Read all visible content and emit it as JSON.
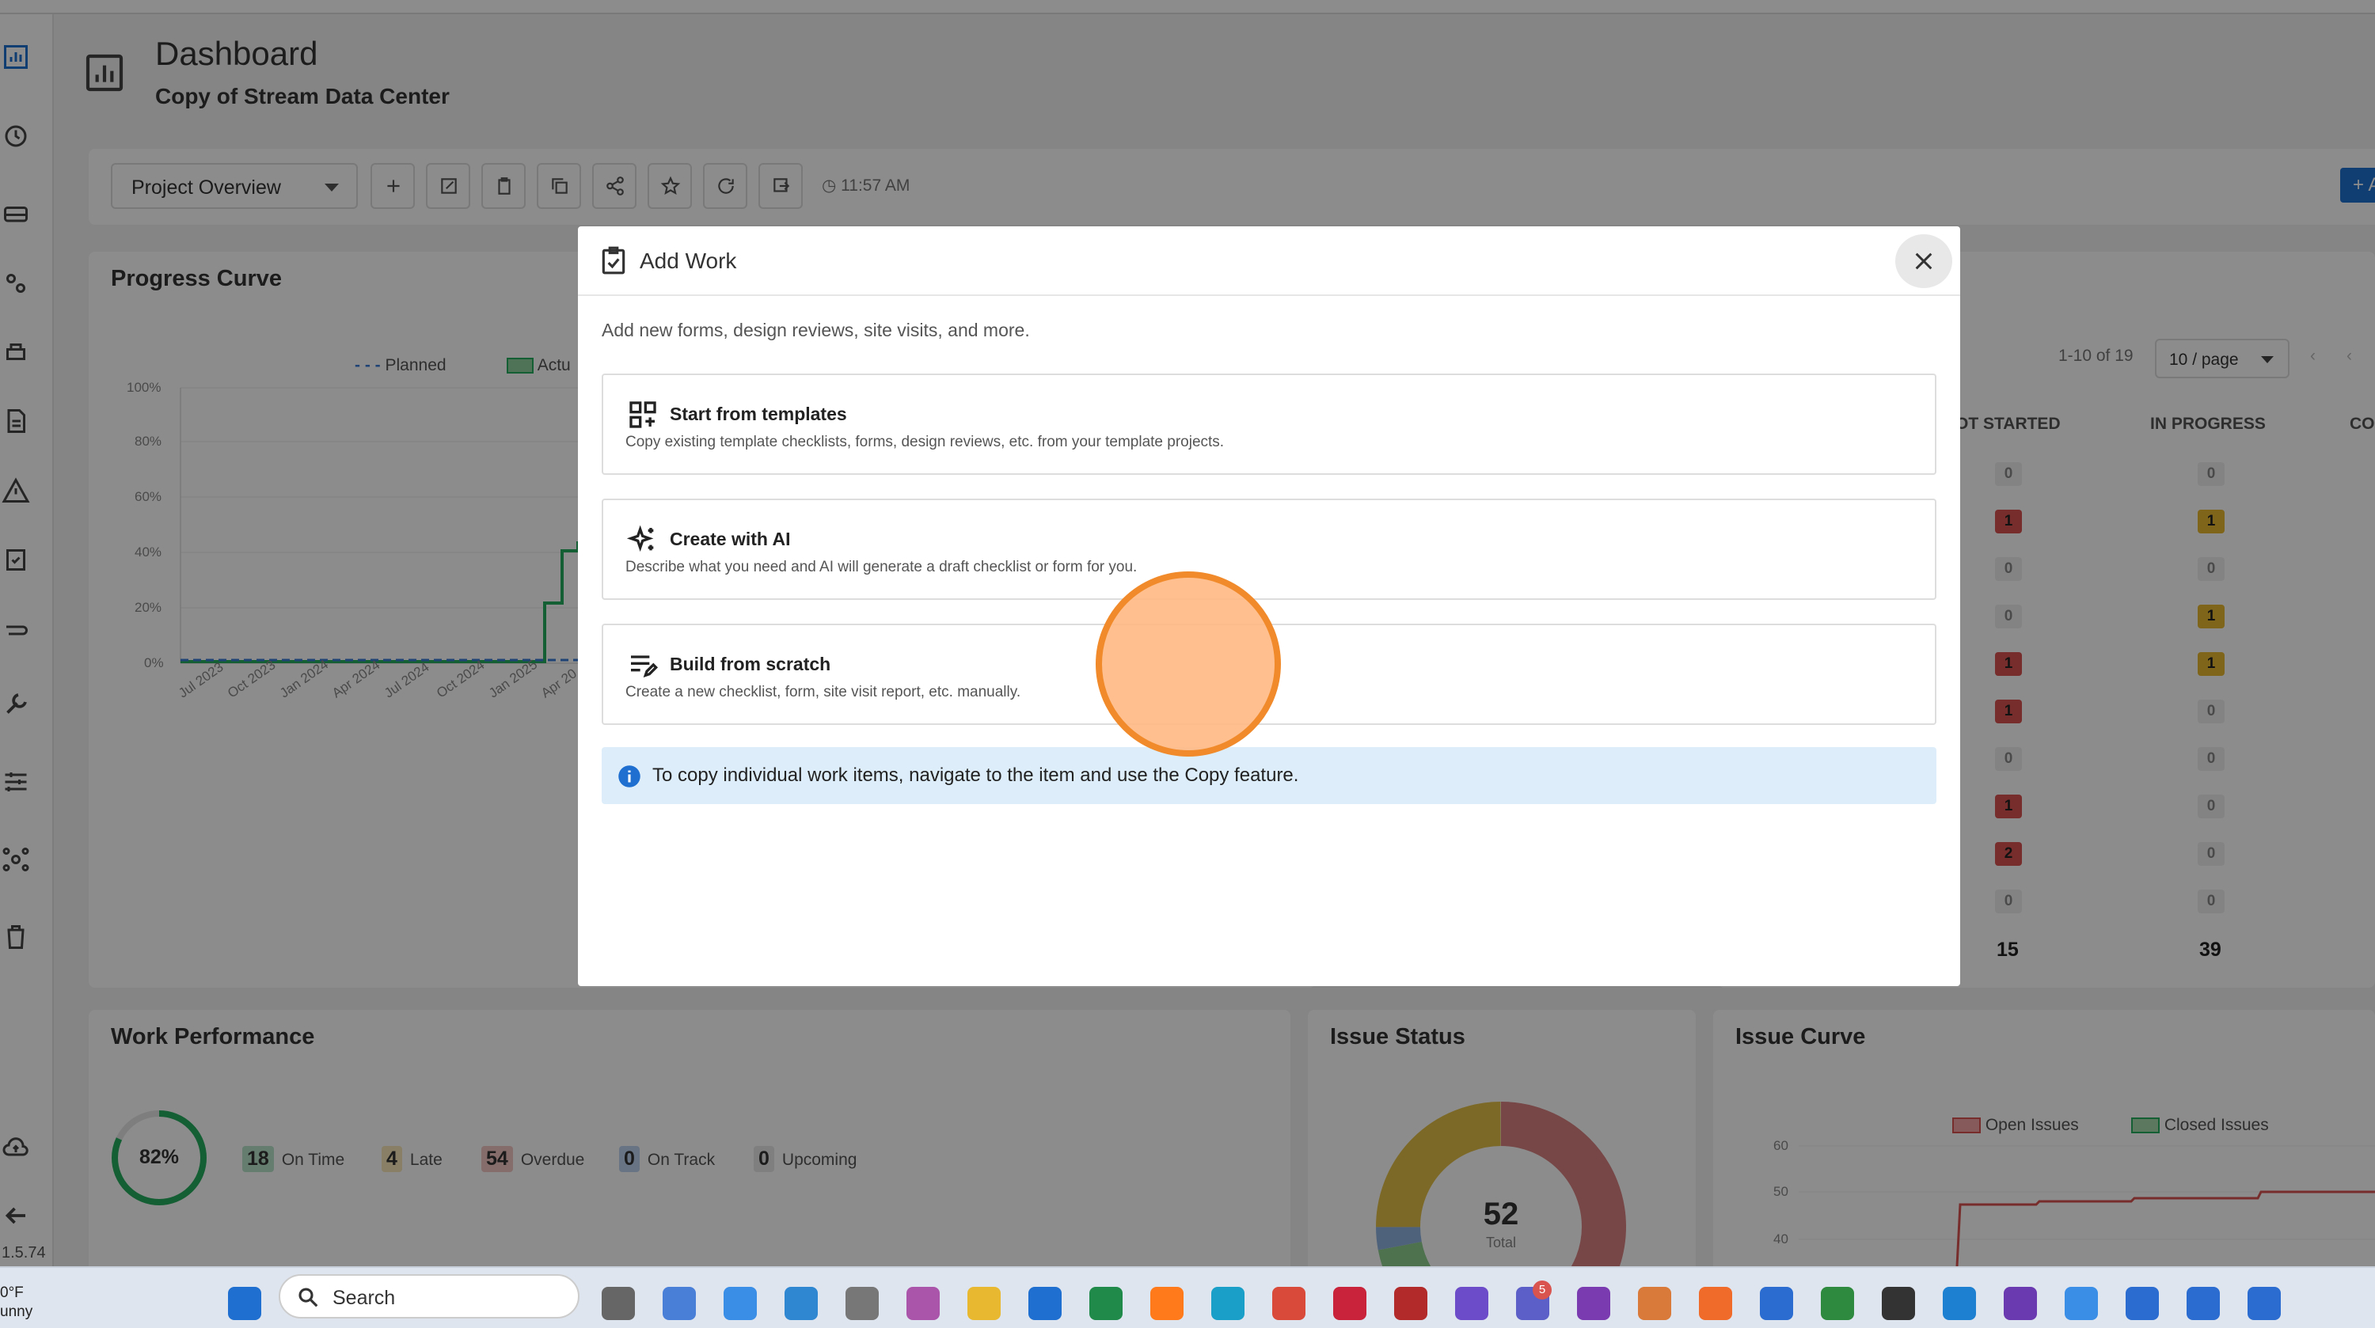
{
  "header": {
    "title": "Dashboard",
    "subtitle": "Copy of Stream Data Center"
  },
  "toolbar": {
    "view_select": "Project Overview",
    "last_refresh": "11:57 AM",
    "primary_button": "+ A"
  },
  "progress_curve": {
    "title": "Progress Curve",
    "legend": {
      "planned": "Planned",
      "actual": "Actu"
    },
    "y_ticks": [
      "100%",
      "80%",
      "60%",
      "40%",
      "20%",
      "0%"
    ],
    "x_ticks": [
      "Jul 2023",
      "Oct 2023",
      "Jan 2024",
      "Apr 2024",
      "Jul 2024",
      "Oct 2024",
      "Jan 2025",
      "Apr 20"
    ]
  },
  "table": {
    "pagination": "1-10 of 19",
    "page_size": "10 / page",
    "columns": [
      "OT STARTED",
      "IN PROGRESS",
      "CO"
    ],
    "rows": [
      {
        "not_started": "0",
        "in_progress": "0",
        "ns_color": "gray",
        "ip_color": "gray"
      },
      {
        "not_started": "1",
        "in_progress": "1",
        "ns_color": "red",
        "ip_color": "yellow"
      },
      {
        "not_started": "0",
        "in_progress": "0",
        "ns_color": "gray",
        "ip_color": "gray"
      },
      {
        "not_started": "0",
        "in_progress": "1",
        "ns_color": "gray",
        "ip_color": "yellow"
      },
      {
        "not_started": "1",
        "in_progress": "1",
        "ns_color": "red",
        "ip_color": "yellow"
      },
      {
        "not_started": "1",
        "in_progress": "0",
        "ns_color": "red",
        "ip_color": "gray"
      },
      {
        "not_started": "0",
        "in_progress": "0",
        "ns_color": "gray",
        "ip_color": "gray"
      },
      {
        "not_started": "1",
        "in_progress": "0",
        "ns_color": "red",
        "ip_color": "gray"
      },
      {
        "not_started": "2",
        "in_progress": "0",
        "ns_color": "red",
        "ip_color": "gray"
      },
      {
        "not_started": "0",
        "in_progress": "0",
        "ns_color": "gray",
        "ip_color": "gray"
      }
    ],
    "totals": {
      "not_started": "15",
      "in_progress": "39"
    }
  },
  "work_performance": {
    "title": "Work Performance",
    "percent": "82%",
    "stats": [
      {
        "value": "18",
        "label": "On Time",
        "color": "#27ae60"
      },
      {
        "value": "4",
        "label": "Late",
        "color": "#e8b830"
      },
      {
        "value": "54",
        "label": "Overdue",
        "color": "#d9534f"
      },
      {
        "value": "0",
        "label": "On Track",
        "color": "#3a7bd5"
      },
      {
        "value": "0",
        "label": "Upcoming",
        "color": "#bbbbbb"
      }
    ]
  },
  "issue_status": {
    "title": "Issue Status",
    "total": "52",
    "total_label": "Total"
  },
  "issue_curve": {
    "title": "Issue Curve",
    "legend": {
      "open": "Open Issues",
      "closed": "Closed Issues"
    },
    "y_ticks": [
      "60",
      "50",
      "40"
    ]
  },
  "modal": {
    "title": "Add Work",
    "description": "Add new forms, design reviews, site visits, and more.",
    "options": [
      {
        "title": "Start from templates",
        "desc": "Copy existing template checklists, forms, design reviews, etc. from your template projects."
      },
      {
        "title": "Create with AI",
        "desc": "Describe what you need and AI will generate a draft checklist or form for you."
      },
      {
        "title": "Build from scratch",
        "desc": "Create a new checklist, form, site visit report, etc. manually."
      }
    ],
    "info": "To copy individual work items, navigate to the item and use the Copy feature."
  },
  "sidebar": {
    "version": "1.5.74"
  },
  "taskbar": {
    "search": "Search",
    "weather_temp": "0°F",
    "weather_cond": "unny",
    "teams_badge": "5"
  }
}
